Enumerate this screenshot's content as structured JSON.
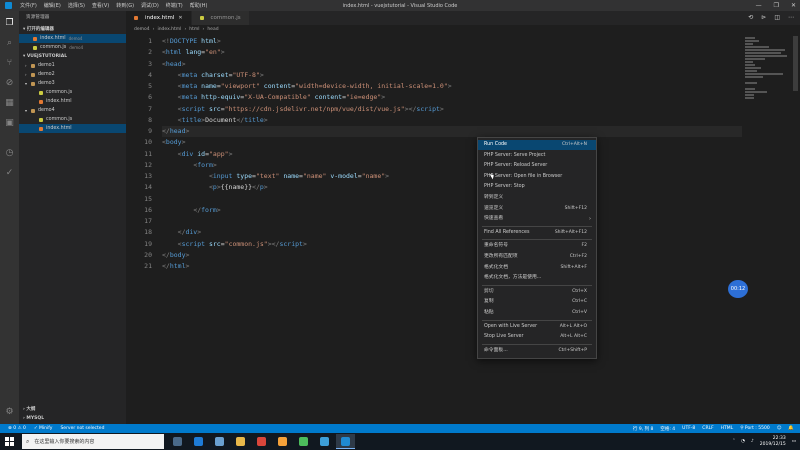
{
  "window": {
    "title": "index.html - vuejstutorial - Visual Studio Code",
    "menu": [
      "文件(F)",
      "编辑(E)",
      "选择(S)",
      "查看(V)",
      "转到(G)",
      "调试(D)",
      "终端(T)",
      "帮助(H)"
    ],
    "controls": [
      "—",
      "❐",
      "✕"
    ]
  },
  "activity_bar": [
    "explorer-icon",
    "search-icon",
    "source-control-icon",
    "debug-icon",
    "extensions-icon",
    "remote-icon",
    "test-icon",
    "settings-icon"
  ],
  "sidebar": {
    "title": "资源管理器",
    "open_editors_label": "打开的编辑器",
    "open_editors": [
      {
        "name": "index.html",
        "folder": "demo4"
      },
      {
        "name": "common.js",
        "folder": "demo4"
      }
    ],
    "workspace_label": "VUEJSTUTORIAL",
    "tree": [
      {
        "name": "demo1",
        "type": "folder",
        "depth": 1,
        "expanded": false
      },
      {
        "name": "demo2",
        "type": "folder",
        "depth": 1,
        "expanded": false
      },
      {
        "name": "demo3",
        "type": "folder",
        "depth": 1,
        "expanded": true
      },
      {
        "name": "common.js",
        "type": "js",
        "depth": 2
      },
      {
        "name": "index.html",
        "type": "html",
        "depth": 2
      },
      {
        "name": "demo4",
        "type": "folder",
        "depth": 1,
        "expanded": true
      },
      {
        "name": "common.js",
        "type": "js",
        "depth": 2
      },
      {
        "name": "index.html",
        "type": "html",
        "depth": 2,
        "selected": true
      }
    ],
    "outline_label": "大纲",
    "mysql_label": "MYSQL"
  },
  "tabs": [
    {
      "label": "index.html",
      "active": true
    },
    {
      "label": "common.js",
      "active": false
    }
  ],
  "breadcrumb": [
    "demo4",
    "index.html",
    "html",
    "head"
  ],
  "editor": {
    "line_numbers": [
      "1",
      "2",
      "3",
      "4",
      "5",
      "6",
      "7",
      "8",
      "9",
      "10",
      "11",
      "12",
      "13",
      "14",
      "15",
      "16",
      "17",
      "18",
      "19",
      "20",
      "21"
    ],
    "lines": [
      [
        [
          "p",
          "<!"
        ],
        [
          "k",
          "DOCTYPE"
        ],
        [
          "t",
          " "
        ],
        [
          "a",
          "html"
        ],
        [
          "p",
          ">"
        ]
      ],
      [
        [
          "p",
          "<"
        ],
        [
          "k",
          "html"
        ],
        [
          "t",
          " "
        ],
        [
          "a",
          "lang"
        ],
        [
          "t",
          "="
        ],
        [
          "s",
          "\"en\""
        ],
        [
          "p",
          ">"
        ]
      ],
      [
        [
          "p",
          "<"
        ],
        [
          "k",
          "head"
        ],
        [
          "p",
          ">"
        ]
      ],
      [
        [
          "t",
          "    "
        ],
        [
          "p",
          "<"
        ],
        [
          "k",
          "meta"
        ],
        [
          "t",
          " "
        ],
        [
          "a",
          "charset"
        ],
        [
          "t",
          "="
        ],
        [
          "s",
          "\"UTF-8\""
        ],
        [
          "p",
          ">"
        ]
      ],
      [
        [
          "t",
          "    "
        ],
        [
          "p",
          "<"
        ],
        [
          "k",
          "meta"
        ],
        [
          "t",
          " "
        ],
        [
          "a",
          "name"
        ],
        [
          "t",
          "="
        ],
        [
          "s",
          "\"viewport\""
        ],
        [
          "t",
          " "
        ],
        [
          "a",
          "content"
        ],
        [
          "t",
          "="
        ],
        [
          "s",
          "\"width=device-width, initial-scale=1.0\""
        ],
        [
          "p",
          ">"
        ]
      ],
      [
        [
          "t",
          "    "
        ],
        [
          "p",
          "<"
        ],
        [
          "k",
          "meta"
        ],
        [
          "t",
          " "
        ],
        [
          "a",
          "http-equiv"
        ],
        [
          "t",
          "="
        ],
        [
          "s",
          "\"X-UA-Compatible\""
        ],
        [
          "t",
          " "
        ],
        [
          "a",
          "content"
        ],
        [
          "t",
          "="
        ],
        [
          "s",
          "\"ie=edge\""
        ],
        [
          "p",
          ">"
        ]
      ],
      [
        [
          "t",
          "    "
        ],
        [
          "p",
          "<"
        ],
        [
          "k",
          "script"
        ],
        [
          "t",
          " "
        ],
        [
          "a",
          "src"
        ],
        [
          "t",
          "="
        ],
        [
          "s",
          "\"https://cdn.jsdelivr.net/npm/vue/dist/vue.js\""
        ],
        [
          "p",
          "></"
        ],
        [
          "k",
          "script"
        ],
        [
          "p",
          ">"
        ]
      ],
      [
        [
          "t",
          "    "
        ],
        [
          "p",
          "<"
        ],
        [
          "k",
          "title"
        ],
        [
          "p",
          ">"
        ],
        [
          "t",
          "Document"
        ],
        [
          "p",
          "</"
        ],
        [
          "k",
          "title"
        ],
        [
          "p",
          ">"
        ]
      ],
      [
        [
          "p",
          "</"
        ],
        [
          "k",
          "head"
        ],
        [
          "p",
          ">"
        ]
      ],
      [
        [
          "p",
          "<"
        ],
        [
          "k",
          "body"
        ],
        [
          "p",
          ">"
        ]
      ],
      [
        [
          "t",
          "    "
        ],
        [
          "p",
          "<"
        ],
        [
          "k",
          "div"
        ],
        [
          "t",
          " "
        ],
        [
          "a",
          "id"
        ],
        [
          "t",
          "="
        ],
        [
          "s",
          "\"app\""
        ],
        [
          "p",
          ">"
        ]
      ],
      [
        [
          "t",
          "        "
        ],
        [
          "p",
          "<"
        ],
        [
          "k",
          "form"
        ],
        [
          "p",
          ">"
        ]
      ],
      [
        [
          "t",
          "            "
        ],
        [
          "p",
          "<"
        ],
        [
          "k",
          "input"
        ],
        [
          "t",
          " "
        ],
        [
          "a",
          "type"
        ],
        [
          "t",
          "="
        ],
        [
          "s",
          "\"text\""
        ],
        [
          "t",
          " "
        ],
        [
          "a",
          "name"
        ],
        [
          "t",
          "="
        ],
        [
          "s",
          "\"name\""
        ],
        [
          "t",
          " "
        ],
        [
          "a",
          "v-model"
        ],
        [
          "t",
          "="
        ],
        [
          "s",
          "\"name\""
        ],
        [
          "p",
          ">"
        ]
      ],
      [
        [
          "t",
          "            "
        ],
        [
          "p",
          "<"
        ],
        [
          "k",
          "p"
        ],
        [
          "p",
          ">"
        ],
        [
          "t",
          "{{name}}"
        ],
        [
          "p",
          "</"
        ],
        [
          "k",
          "p"
        ],
        [
          "p",
          ">"
        ]
      ],
      [
        [
          "t",
          ""
        ]
      ],
      [
        [
          "t",
          "        "
        ],
        [
          "p",
          "</"
        ],
        [
          "k",
          "form"
        ],
        [
          "p",
          ">"
        ]
      ],
      [
        [
          "t",
          ""
        ]
      ],
      [
        [
          "t",
          "    "
        ],
        [
          "p",
          "</"
        ],
        [
          "k",
          "div"
        ],
        [
          "p",
          ">"
        ]
      ],
      [
        [
          "t",
          "    "
        ],
        [
          "p",
          "<"
        ],
        [
          "k",
          "script"
        ],
        [
          "t",
          " "
        ],
        [
          "a",
          "src"
        ],
        [
          "t",
          "="
        ],
        [
          "s",
          "\"common.js\""
        ],
        [
          "p",
          "></"
        ],
        [
          "k",
          "script"
        ],
        [
          "p",
          ">"
        ]
      ],
      [
        [
          "p",
          "</"
        ],
        [
          "k",
          "body"
        ],
        [
          "p",
          ">"
        ]
      ],
      [
        [
          "p",
          "</"
        ],
        [
          "k",
          "html"
        ],
        [
          "p",
          ">"
        ]
      ]
    ],
    "current_line": 9
  },
  "context_menu": {
    "items": [
      {
        "label": "Run Code",
        "shortcut": "Ctrl+Alt+N",
        "highlighted": true
      },
      {
        "label": "PHP Server: Serve Project",
        "shortcut": ""
      },
      {
        "label": "PHP Server: Reload Server",
        "shortcut": ""
      },
      {
        "label": "PHP Server: Open file in Browser",
        "shortcut": ""
      },
      {
        "label": "PHP Server: Stop",
        "shortcut": ""
      },
      {
        "label": "转到定义",
        "shortcut": ""
      },
      {
        "label": "速览定义",
        "shortcut": "Shift+F12"
      },
      {
        "label": "快速查看",
        "shortcut": "",
        "submenu": true
      },
      {
        "sep": true
      },
      {
        "label": "Find All References",
        "shortcut": "Shift+Alt+F12"
      },
      {
        "sep": true
      },
      {
        "label": "重命名符号",
        "shortcut": "F2"
      },
      {
        "label": "更改所有匹配项",
        "shortcut": "Ctrl+F2"
      },
      {
        "label": "格式化文档",
        "shortcut": "Shift+Alt+F"
      },
      {
        "label": "格式化文档，方法是使用...",
        "shortcut": ""
      },
      {
        "sep": true
      },
      {
        "label": "剪切",
        "shortcut": "Ctrl+X"
      },
      {
        "label": "复制",
        "shortcut": "Ctrl+C"
      },
      {
        "label": "粘贴",
        "shortcut": "Ctrl+V"
      },
      {
        "sep": true
      },
      {
        "label": "Open with Live Server",
        "shortcut": "Alt+L Alt+O"
      },
      {
        "label": "Stop Live Server",
        "shortcut": "Alt+L Alt+C"
      },
      {
        "sep": true
      },
      {
        "label": "命令面板...",
        "shortcut": "Ctrl+Shift+P"
      }
    ]
  },
  "time_bubble": "00:12",
  "status_bar": {
    "left": [
      "⊗ 0 ⚠ 0",
      "✓ Minify",
      "Server not selected"
    ],
    "right": [
      "行 9, 列 8",
      "空格: 4",
      "UTF-8",
      "CRLF",
      "HTML",
      "⚲ Port : 5500",
      "☺",
      "🔔"
    ]
  },
  "taskbar": {
    "search_placeholder": "在这里输入你要搜索的内容",
    "apps": [
      {
        "name": "task-view-icon",
        "color": "#4a6a8a",
        "active": false
      },
      {
        "name": "edge-icon",
        "color": "#1e7bd6",
        "active": false
      },
      {
        "name": "store-icon",
        "color": "#6aa0d0",
        "active": false
      },
      {
        "name": "explorer-icon",
        "color": "#e8b84a",
        "active": false
      },
      {
        "name": "chrome-icon",
        "color": "#d9463b",
        "active": false
      },
      {
        "name": "photos-icon",
        "color": "#f4a13a",
        "active": false
      },
      {
        "name": "wechat-icon",
        "color": "#4cbd5c",
        "active": false
      },
      {
        "name": "app-icon",
        "color": "#3d9fd8",
        "active": false
      },
      {
        "name": "vscode-icon",
        "color": "#1f8ad2",
        "active": true
      }
    ],
    "time": "22:33",
    "date": "2019/12/15"
  }
}
